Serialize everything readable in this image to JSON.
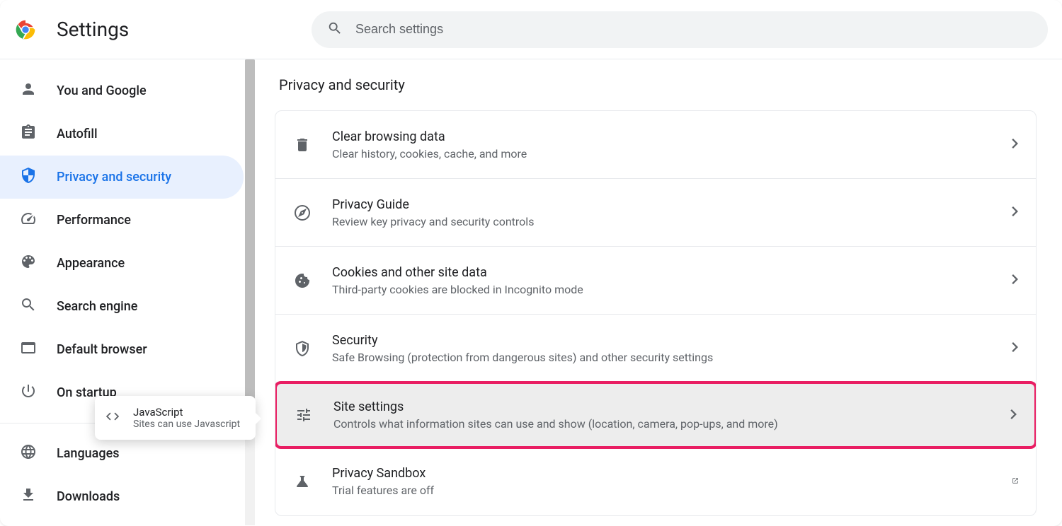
{
  "header": {
    "title": "Settings",
    "search_placeholder": "Search settings"
  },
  "sidebar": {
    "items": [
      {
        "label": "You and Google"
      },
      {
        "label": "Autofill"
      },
      {
        "label": "Privacy and security"
      },
      {
        "label": "Performance"
      },
      {
        "label": "Appearance"
      },
      {
        "label": "Search engine"
      },
      {
        "label": "Default browser"
      },
      {
        "label": "On startup"
      },
      {
        "label": "Languages"
      },
      {
        "label": "Downloads"
      }
    ]
  },
  "main": {
    "section_title": "Privacy and security",
    "rows": [
      {
        "title": "Clear browsing data",
        "sub": "Clear history, cookies, cache, and more"
      },
      {
        "title": "Privacy Guide",
        "sub": "Review key privacy and security controls"
      },
      {
        "title": "Cookies and other site data",
        "sub": "Third-party cookies are blocked in Incognito mode"
      },
      {
        "title": "Security",
        "sub": "Safe Browsing (protection from dangerous sites) and other security settings"
      },
      {
        "title": "Site settings",
        "sub": "Controls what information sites can use and show (location, camera, pop-ups, and more)"
      },
      {
        "title": "Privacy Sandbox",
        "sub": "Trial features are off"
      }
    ]
  },
  "tooltip": {
    "title": "JavaScript",
    "sub": "Sites can use Javascript"
  }
}
